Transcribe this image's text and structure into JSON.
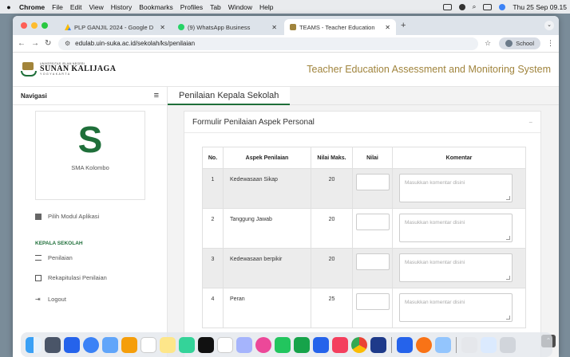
{
  "menubar": {
    "app": "Chrome",
    "items": [
      "File",
      "Edit",
      "View",
      "History",
      "Bookmarks",
      "Profiles",
      "Tab",
      "Window",
      "Help"
    ],
    "clock": "Thu 25 Sep 09.15"
  },
  "browser": {
    "tabs": [
      {
        "label": "PLP GANJIL 2024 - Google D"
      },
      {
        "label": "(9) WhatsApp Business"
      },
      {
        "label": "TEAMS - Teacher Education"
      }
    ],
    "url": "edulab.uin-suka.ac.id/sekolah/ks/penilaian",
    "profile": "School"
  },
  "header": {
    "logo_top": "UNIVERSITAS ISLAM NEGERI",
    "logo_main": "SUNAN KALIJAGA",
    "logo_sub": "YOGYAKARTA",
    "system_title": "Teacher Education Assessment and Monitoring System"
  },
  "sidebar": {
    "title": "Navigasi",
    "initial": "S",
    "school_name": "SMA Kolombo",
    "module_link": "Pilih Modul Aplikasi",
    "section": "KEPALA SEKOLAH",
    "items": [
      {
        "label": "Penilaian"
      },
      {
        "label": "Rekapitulasi Penilaian"
      },
      {
        "label": "Logout"
      }
    ]
  },
  "main": {
    "page_title": "Penilaian Kepala Sekolah",
    "card_title": "Formulir Penilaian Aspek Personal",
    "table": {
      "headers": [
        "No.",
        "Aspek Penilaian",
        "Nilai Maks.",
        "Nilai",
        "Komentar"
      ],
      "rows": [
        {
          "no": "1",
          "aspek": "Kedewasaan Sikap",
          "maks": "20"
        },
        {
          "no": "2",
          "aspek": "Tanggung Jawab",
          "maks": "20"
        },
        {
          "no": "3",
          "aspek": "Kedewasaan berpikir",
          "maks": "20"
        },
        {
          "no": "4",
          "aspek": "Peran",
          "maks": "25"
        }
      ],
      "comment_placeholder": "Masukkan komentar disini"
    }
  },
  "colors": {
    "accent_green": "#1f6f3a",
    "gold": "#a0843d"
  }
}
